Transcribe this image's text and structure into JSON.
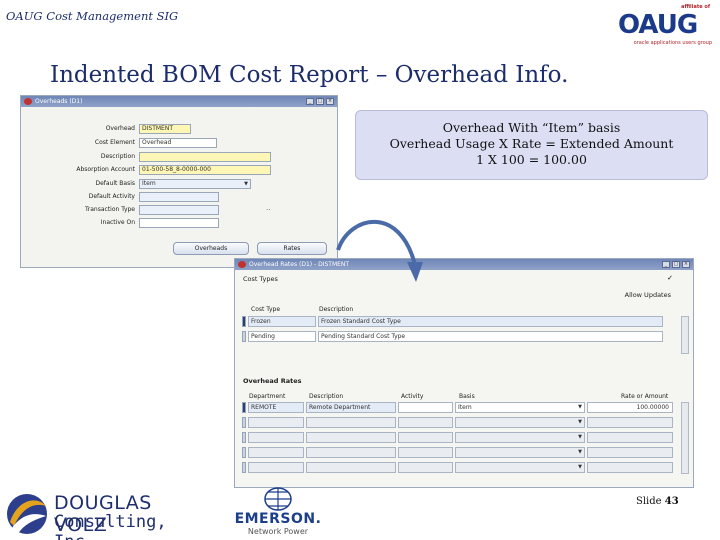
{
  "header": {
    "sig_title": "OAUG Cost Management SIG",
    "oaug_logo": {
      "affiliation": "affiliate of",
      "wordmark": "OAUG",
      "tagline": "oracle applications users group"
    }
  },
  "slide_title": "Indented BOM Cost Report – Overhead Info.",
  "callout": {
    "line1": "Overhead With “Item” basis",
    "line2": "Overhead Usage X Rate = Extended Amount",
    "line3": "1 X 100 = 100.00"
  },
  "window1": {
    "title": "Overheads (D1)",
    "fields": [
      {
        "label": "Overhead",
        "value": "DISTMENT",
        "style": "yellow"
      },
      {
        "label": "Cost Element",
        "value": "Overhead",
        "style": "plain"
      },
      {
        "label": "Description",
        "value": "",
        "style": "yellow"
      },
      {
        "label": "Absorption Account",
        "value": "01-500-58_8-0000-000",
        "style": "yellow"
      },
      {
        "label": "Default Basis",
        "value": "Item",
        "style": "dropdown"
      },
      {
        "label": "Default Activity",
        "value": "",
        "style": "plain"
      },
      {
        "label": "Transaction Type",
        "value": "",
        "style": "plain"
      },
      {
        "label": "Inactive On",
        "value": "",
        "style": "plain"
      }
    ],
    "buttons": {
      "overheads": "Overheads",
      "rates": "Rates"
    },
    "ellipsis": ".."
  },
  "window2": {
    "title": "Overhead Rates (D1) - DISTMENT",
    "cost_types_label": "Cost Types",
    "allow_updates_label": "Allow Updates",
    "cost_types_headers": {
      "cost_type": "Cost Type",
      "description": "Description"
    },
    "cost_types": [
      {
        "cost_type": "Frozen",
        "description": "Frozen Standard Cost Type"
      },
      {
        "cost_type": "Pending",
        "description": "Pending Standard Cost Type"
      }
    ],
    "overhead_rates_label": "Overhead Rates",
    "rates_headers": {
      "department": "Department",
      "description": "Description",
      "activity": "Activity",
      "basis": "Basis",
      "rate": "Rate or Amount"
    },
    "rates": [
      {
        "department": "REMOTE",
        "description": "Remote Department",
        "activity": "",
        "basis": "Item",
        "rate": "100.00000"
      }
    ]
  },
  "footer": {
    "dv_name": "DOUGLAS VOLZ",
    "dv_sub": "Consulting, Inc.",
    "emerson_name": "EMERSON.",
    "emerson_sub": "Network Power",
    "slide_label": "Slide",
    "slide_number": "43"
  },
  "colors": {
    "title_navy": "#1c2d6b",
    "titlebar_blue": "#7a8fbd",
    "callout_lavender": "#dcdff4",
    "field_yellow": "#fdf6b4"
  }
}
